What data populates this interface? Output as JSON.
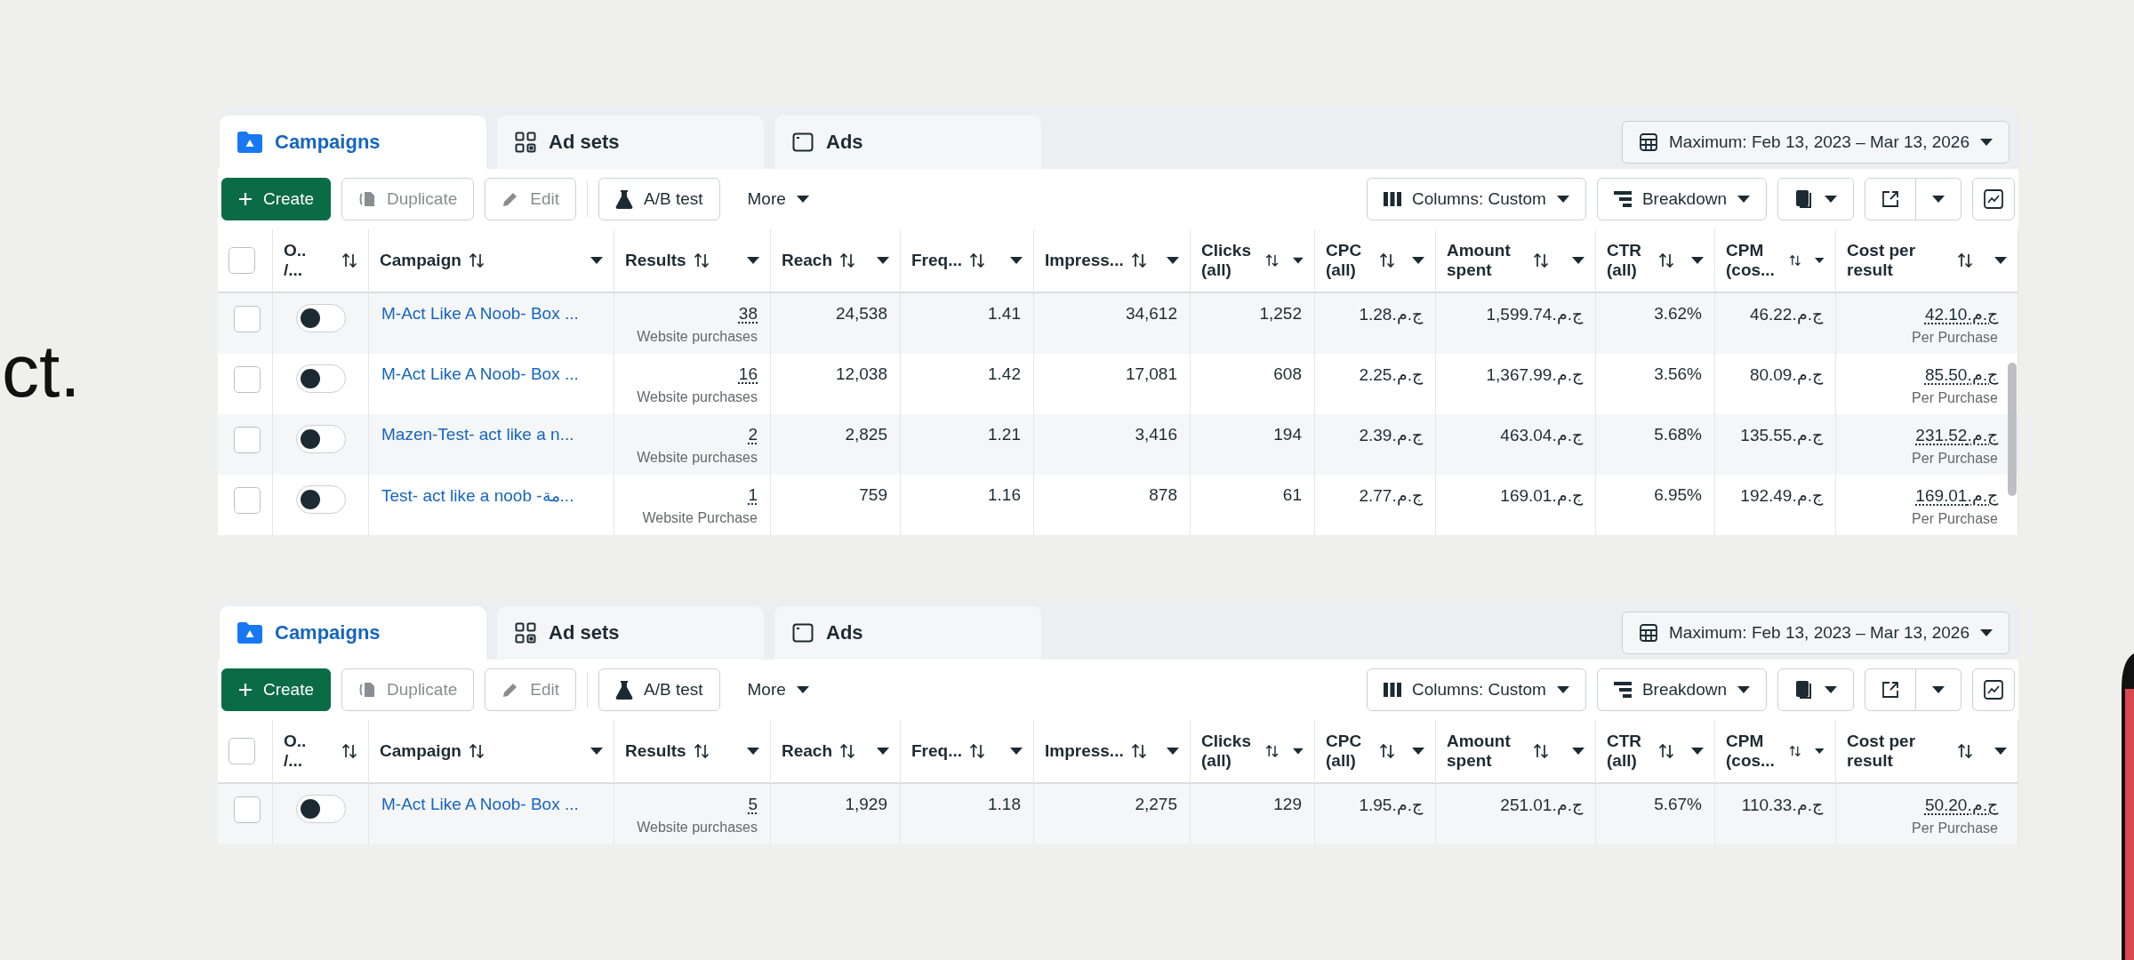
{
  "slide_text": "ct.",
  "panels": [
    {
      "tabs": [
        {
          "kind": "campaigns",
          "label": "Campaigns",
          "selected": true
        },
        {
          "kind": "adsets",
          "label": "Ad sets",
          "selected": false
        },
        {
          "kind": "ads",
          "label": "Ads",
          "selected": false
        }
      ],
      "date_range": "Maximum: Feb 13, 2023 – Mar 13, 2026",
      "toolbar": {
        "create": "Create",
        "duplicate": {
          "label": "Duplicate",
          "disabled": true
        },
        "edit": {
          "label": "Edit",
          "disabled": true
        },
        "ab_test": "A/B test",
        "more": "More",
        "columns": "Columns: Custom",
        "breakdown": "Breakdown"
      },
      "columns": [
        "O.. /...",
        "Campaign",
        "Results",
        "Reach",
        "Freq...",
        "Impress...",
        "Clicks (all)",
        "CPC (all)",
        "Amount spent",
        "CTR (all)",
        "CPM (cos...",
        "Cost per result"
      ],
      "rows": [
        {
          "selected": false,
          "on": false,
          "campaign": "M-Act Like A Noob- Box ...",
          "results": {
            "value": "38",
            "label": "Website purchases"
          },
          "reach": "24,538",
          "frequency": "1.41",
          "impressions": "34,612",
          "clicks": "1,252",
          "cpc": "ج.م.1.28",
          "amount_spent": "ج.م.1,599.74",
          "ctr": "3.62%",
          "cpm": "ج.م.46.22",
          "cost_per_result": {
            "value": "ج.م.42.10",
            "label": "Per Purchase"
          }
        },
        {
          "selected": false,
          "on": false,
          "campaign": "M-Act Like A Noob- Box ...",
          "results": {
            "value": "16",
            "label": "Website purchases"
          },
          "reach": "12,038",
          "frequency": "1.42",
          "impressions": "17,081",
          "clicks": "608",
          "cpc": "ج.م.2.25",
          "amount_spent": "ج.م.1,367.99",
          "ctr": "3.56%",
          "cpm": "ج.م.80.09",
          "cost_per_result": {
            "value": "ج.م.85.50",
            "label": "Per Purchase"
          }
        },
        {
          "selected": false,
          "on": false,
          "campaign": "Mazen-Test- act like a n...",
          "results": {
            "value": "2",
            "label": "Website purchases"
          },
          "reach": "2,825",
          "frequency": "1.21",
          "impressions": "3,416",
          "clicks": "194",
          "cpc": "ج.م.2.39",
          "amount_spent": "ج.م.463.04",
          "ctr": "5.68%",
          "cpm": "ج.م.135.55",
          "cost_per_result": {
            "value": "ج.م.231.52",
            "label": "Per Purchase"
          }
        },
        {
          "selected": false,
          "on": false,
          "campaign": "Test- act like a noob -مة...",
          "results": {
            "value": "1",
            "label": "Website Purchase"
          },
          "reach": "759",
          "frequency": "1.16",
          "impressions": "878",
          "clicks": "61",
          "cpc": "ج.م.2.77",
          "amount_spent": "ج.م.169.01",
          "ctr": "6.95%",
          "cpm": "ج.م.192.49",
          "cost_per_result": {
            "value": "ج.م.169.01",
            "label": "Per Purchase"
          }
        }
      ],
      "all_selected": false
    },
    {
      "tabs": [
        {
          "kind": "campaigns",
          "label": "Campaigns",
          "selected": true
        },
        {
          "kind": "adsets",
          "label": "Ad sets",
          "selected": false
        },
        {
          "kind": "ads",
          "label": "Ads",
          "selected": false
        }
      ],
      "date_range": "Maximum: Feb 13, 2023 – Mar 13, 2026",
      "toolbar": {
        "create": "Create",
        "duplicate": {
          "label": "Duplicate",
          "disabled": true
        },
        "edit": {
          "label": "Edit",
          "disabled": true
        },
        "ab_test": "A/B test",
        "more": "More",
        "columns": "Columns: Custom",
        "breakdown": "Breakdown"
      },
      "columns": [
        "O.. /...",
        "Campaign",
        "Results",
        "Reach",
        "Freq...",
        "Impress...",
        "Clicks (all)",
        "CPC (all)",
        "Amount spent",
        "CTR (all)",
        "CPM (cos...",
        "Cost per result"
      ],
      "rows": [
        {
          "selected": false,
          "on": false,
          "campaign": "M-Act Like A Noob- Box ...",
          "results": {
            "value": "5",
            "label": "Website purchases"
          },
          "reach": "1,929",
          "frequency": "1.18",
          "impressions": "2,275",
          "clicks": "129",
          "cpc": "ج.م.1.95",
          "amount_spent": "ج.م.251.01",
          "ctr": "5.67%",
          "cpm": "ج.م.110.33",
          "cost_per_result": {
            "value": "ج.م.50.20",
            "label": "Per Purchase"
          }
        }
      ],
      "all_selected": false
    }
  ]
}
